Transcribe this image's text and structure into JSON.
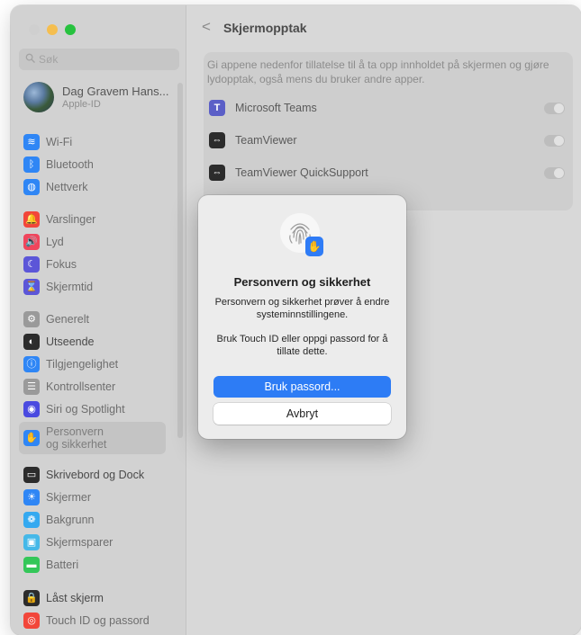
{
  "sidebar": {
    "search_placeholder": "Søk",
    "account": {
      "name": "Dag Gravem Hans...",
      "subtitle": "Apple-ID"
    },
    "items": [
      {
        "label": "Wi-Fi",
        "icon": "wifi-icon",
        "color": "#2f86f5",
        "glyph": "≋"
      },
      {
        "label": "Bluetooth",
        "icon": "bluetooth-icon",
        "color": "#2f86f5",
        "glyph": "ᛒ"
      },
      {
        "label": "Nettverk",
        "icon": "globe-icon",
        "color": "#2f86f5",
        "glyph": "◍"
      },
      {
        "label": "Varslinger",
        "icon": "bell-icon",
        "color": "#f2463a",
        "glyph": "🔔"
      },
      {
        "label": "Lyd",
        "icon": "speaker-icon",
        "color": "#f0455c",
        "glyph": "🔊"
      },
      {
        "label": "Fokus",
        "icon": "moon-icon",
        "color": "#5c56d8",
        "glyph": "☾"
      },
      {
        "label": "Skjermtid",
        "icon": "hourglass-icon",
        "color": "#5c56d8",
        "glyph": "⌛"
      },
      {
        "label": "Generelt",
        "icon": "gear-icon",
        "color": "#9a9a9a",
        "glyph": "⚙"
      },
      {
        "label": "Utseende",
        "icon": "appearance-icon",
        "color": "#2c2c2c",
        "glyph": "◐"
      },
      {
        "label": "Tilgjengelighet",
        "icon": "accessibility-icon",
        "color": "#2f86f5",
        "glyph": "ⓘ"
      },
      {
        "label": "Kontrollsenter",
        "icon": "control-center-icon",
        "color": "#9a9a9a",
        "glyph": "☰"
      },
      {
        "label": "Siri og Spotlight",
        "icon": "siri-icon",
        "color": "#4a4ae0",
        "glyph": "◉"
      },
      {
        "label": "Personvern\nog sikkerhet",
        "icon": "hand-icon",
        "color": "#2f86f5",
        "glyph": "✋"
      },
      {
        "label": "Skrivebord og Dock",
        "icon": "dock-icon",
        "color": "#2c2c2c",
        "glyph": "▭"
      },
      {
        "label": "Skjermer",
        "icon": "display-icon",
        "color": "#2f86f5",
        "glyph": "☀"
      },
      {
        "label": "Bakgrunn",
        "icon": "wallpaper-icon",
        "color": "#34a9f0",
        "glyph": "❁"
      },
      {
        "label": "Skjermsparer",
        "icon": "screensaver-icon",
        "color": "#45b8e8",
        "glyph": "▣"
      },
      {
        "label": "Batteri",
        "icon": "battery-icon",
        "color": "#34c759",
        "glyph": "▬"
      },
      {
        "label": "Låst skjerm",
        "icon": "lock-icon",
        "color": "#2c2c2c",
        "glyph": "🔒"
      },
      {
        "label": "Touch ID og passord",
        "icon": "fingerprint-icon",
        "color": "#f2463a",
        "glyph": "◎"
      }
    ]
  },
  "main": {
    "back_glyph": "<",
    "title": "Skjermopptak",
    "description": "Gi appene nedenfor tillatelse til å ta opp innholdet på skjermen og gjøre lydopptak, også mens du bruker andre apper.",
    "apps": [
      {
        "name": "Microsoft Teams",
        "icon": "teams-icon",
        "color": "#5b5fc7",
        "glyph": "T",
        "enabled": true
      },
      {
        "name": "TeamViewer",
        "icon": "teamviewer-icon",
        "color": "#2c2c2c",
        "glyph": "⇔",
        "enabled": true
      },
      {
        "name": "TeamViewer QuickSupport",
        "icon": "teamviewer-qs-icon",
        "color": "#2c2c2c",
        "glyph": "⇔",
        "enabled": true
      }
    ]
  },
  "dialog": {
    "title": "Personvern og sikkerhet",
    "message": "Personvern og sikkerhet prøver å endre systeminnstillingene.",
    "message2": "Bruk Touch ID eller oppgi passord for å tillate dette.",
    "primary_label": "Bruk passord...",
    "cancel_label": "Avbryt"
  }
}
